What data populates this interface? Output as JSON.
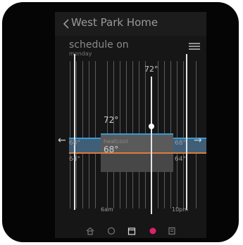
{
  "header": {
    "back_icon": "chevron-left-icon",
    "title": "West Park Home"
  },
  "schedule": {
    "status": "schedule on",
    "day": "monday",
    "menu_icon": "hamburger-menu-icon"
  },
  "setpoint": {
    "current": "72°"
  },
  "segments": [
    {
      "cool": "68°",
      "heat": "64°"
    },
    {
      "cool": "72°",
      "mode": "heatcool",
      "heat": "68°"
    },
    {
      "cool": "68°",
      "heat": "64°"
    }
  ],
  "time_labels": {
    "start": "6am",
    "end": "10pm"
  },
  "nav": {
    "items": [
      {
        "icon": "home-icon"
      },
      {
        "icon": "thermostat-icon"
      },
      {
        "icon": "calendar-icon"
      },
      {
        "icon": "alert-icon"
      },
      {
        "icon": "settings-icon"
      }
    ]
  },
  "colors": {
    "cool": "#3a9ad6",
    "heat": "#e07a3c",
    "active": "#e0206a",
    "band": "#5a5a5a"
  }
}
